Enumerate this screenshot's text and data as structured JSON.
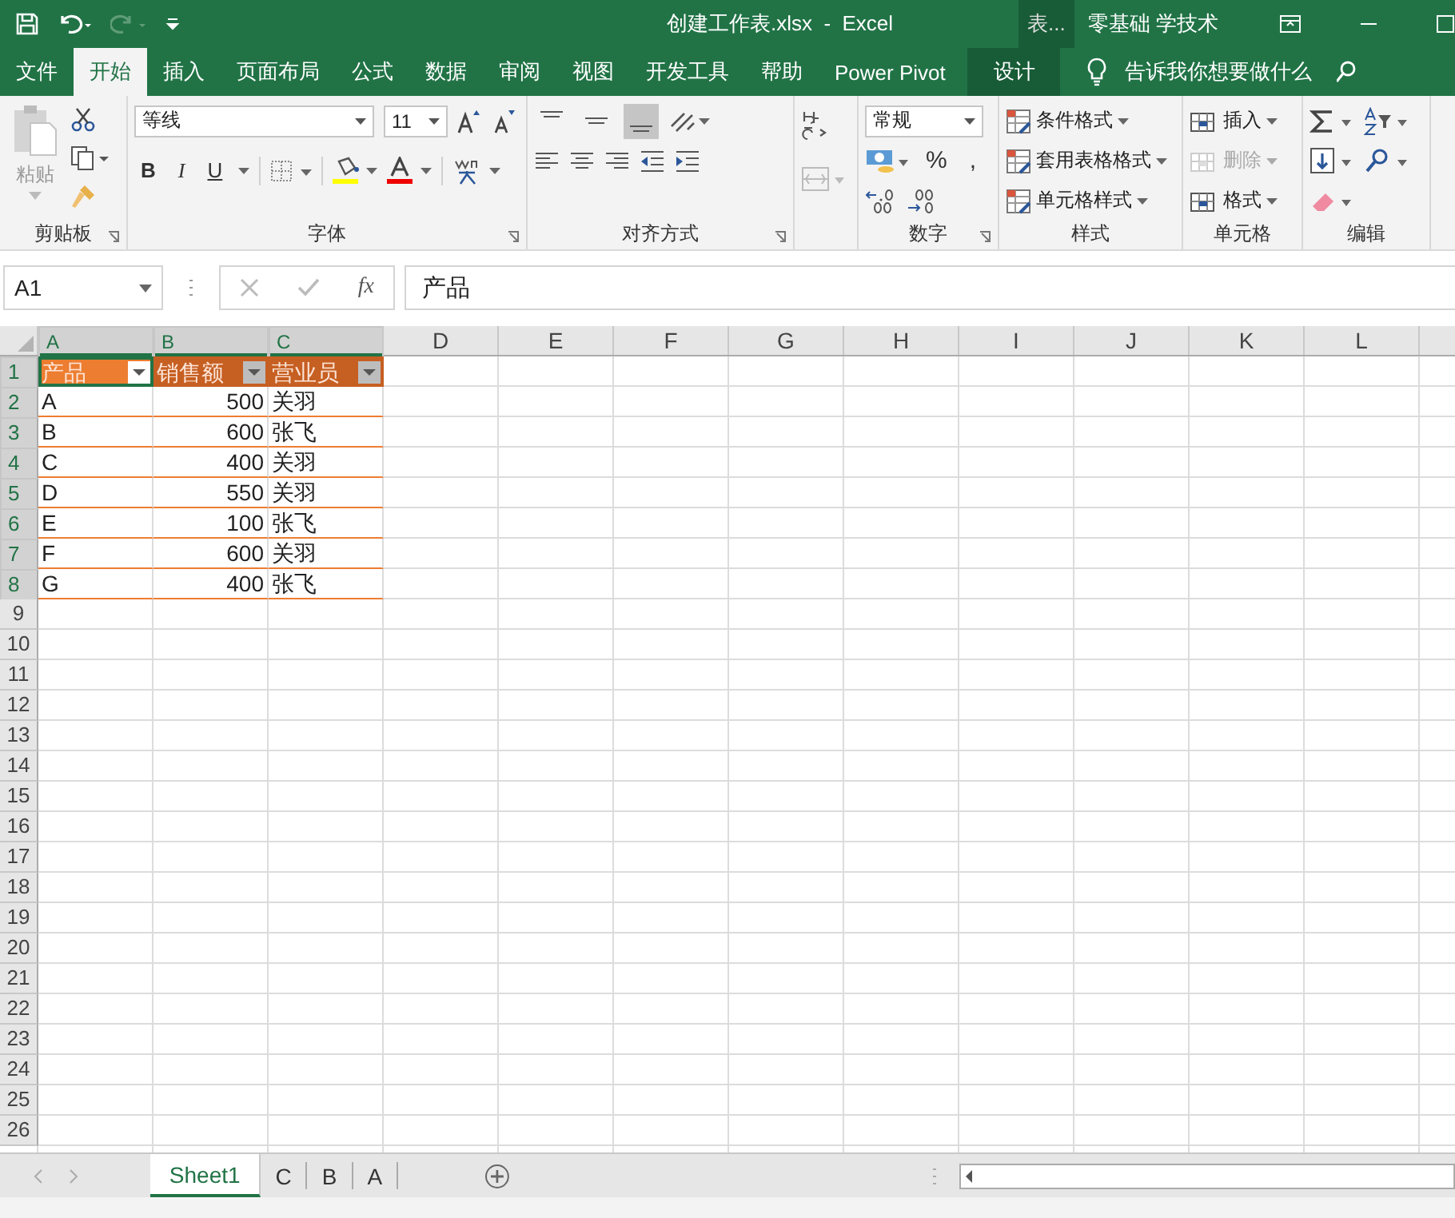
{
  "window": {
    "title": "创建工作表.xlsx  -  Excel",
    "context_group": "表...",
    "user": "零基础 学技术"
  },
  "ribbon_tabs": [
    {
      "label": "文件",
      "selected": false,
      "kind": "file"
    },
    {
      "label": "开始",
      "selected": true,
      "kind": "tab"
    },
    {
      "label": "插入",
      "selected": false,
      "kind": "tab"
    },
    {
      "label": "页面布局",
      "selected": false,
      "kind": "tab"
    },
    {
      "label": "公式",
      "selected": false,
      "kind": "tab"
    },
    {
      "label": "数据",
      "selected": false,
      "kind": "tab"
    },
    {
      "label": "审阅",
      "selected": false,
      "kind": "tab"
    },
    {
      "label": "视图",
      "selected": false,
      "kind": "tab"
    },
    {
      "label": "开发工具",
      "selected": false,
      "kind": "tab"
    },
    {
      "label": "帮助",
      "selected": false,
      "kind": "tab"
    },
    {
      "label": "Power Pivot",
      "selected": false,
      "kind": "tab"
    },
    {
      "label": "设计",
      "selected": false,
      "kind": "context"
    }
  ],
  "tell_me": {
    "placeholder": "告诉我你想要做什么"
  },
  "ribbon": {
    "clipboard": {
      "paste": "粘贴",
      "label": "剪贴板"
    },
    "font": {
      "font_name": "等线",
      "font_size": "11",
      "format_buttons": [
        "B",
        "I",
        "U"
      ],
      "label": "字体"
    },
    "alignment": {
      "vertical_align": [
        {
          "selected": false
        },
        {
          "selected": false
        },
        {
          "selected": true
        }
      ],
      "label": "对齐方式"
    },
    "number": {
      "format": "常规",
      "symbols": [
        "%",
        ","
      ],
      "label": "数字"
    },
    "styles": {
      "items": [
        "条件格式",
        "套用表格格式",
        "单元格样式"
      ],
      "label": "样式"
    },
    "cells": {
      "items": [
        {
          "label": "插入",
          "disabled": false
        },
        {
          "label": "删除",
          "disabled": true
        },
        {
          "label": "格式",
          "disabled": false
        }
      ],
      "label": "单元格"
    },
    "editing": {
      "label": "编辑"
    }
  },
  "formula_bar": {
    "name_box": "A1",
    "fx": "fx",
    "value": "产品"
  },
  "sheet": {
    "columns": [
      "A",
      "B",
      "C",
      "D",
      "E",
      "F",
      "G",
      "H",
      "I",
      "J",
      "K",
      "L"
    ],
    "selected_columns": [
      true,
      true,
      true,
      false,
      false,
      false,
      false,
      false,
      false,
      false,
      false,
      false
    ],
    "row_headers": [
      "1",
      "2",
      "3",
      "4",
      "5",
      "6",
      "7",
      "8",
      "9",
      "10",
      "11",
      "12",
      "13",
      "14",
      "15",
      "16",
      "17",
      "18",
      "19",
      "20",
      "21",
      "22",
      "23",
      "24",
      "25",
      "26"
    ],
    "table_headers": [
      {
        "label": "产品",
        "shaded": false
      },
      {
        "label": "销售额",
        "shaded": true
      },
      {
        "label": "营业员",
        "shaded": true
      }
    ],
    "table_rows": [
      [
        "A",
        "500",
        "关羽"
      ],
      [
        "B",
        "600",
        "张飞"
      ],
      [
        "C",
        "400",
        "关羽"
      ],
      [
        "D",
        "550",
        "关羽"
      ],
      [
        "E",
        "100",
        "张飞"
      ],
      [
        "F",
        "600",
        "关羽"
      ],
      [
        "G",
        "400",
        "张飞"
      ]
    ]
  },
  "sheet_tabs": [
    {
      "label": "Sheet1",
      "selected": true
    },
    {
      "label": "C",
      "selected": false
    },
    {
      "label": "B",
      "selected": false
    },
    {
      "label": "A",
      "selected": false
    }
  ]
}
